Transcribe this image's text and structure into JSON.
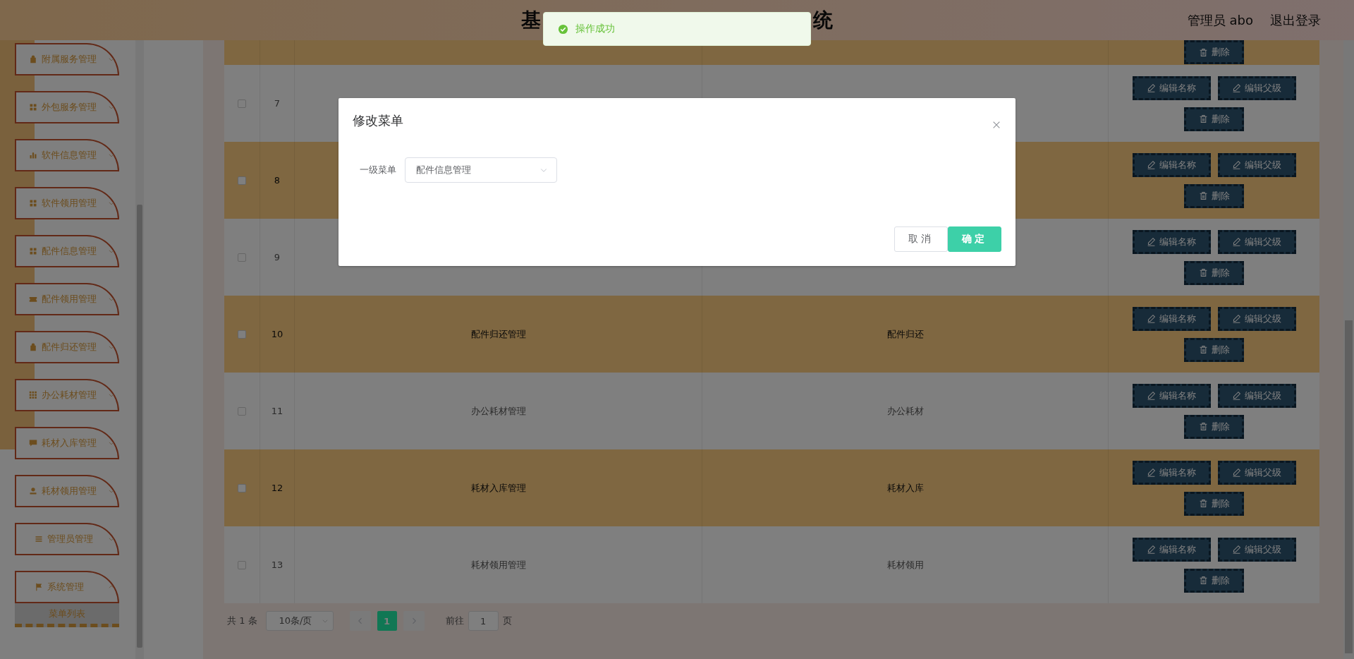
{
  "header": {
    "title_start": "基",
    "title_end": "统",
    "user": "管理员 abo",
    "logout": "退出登录"
  },
  "toast": {
    "kind": "success",
    "message": "操作成功"
  },
  "sidebar": {
    "items": [
      {
        "label": "附属服务管理",
        "expanded": false
      },
      {
        "label": "外包服务管理",
        "expanded": false
      },
      {
        "label": "软件信息管理",
        "expanded": false
      },
      {
        "label": "软件领用管理",
        "expanded": false
      },
      {
        "label": "配件信息管理",
        "expanded": false
      },
      {
        "label": "配件领用管理",
        "expanded": false
      },
      {
        "label": "配件归还管理",
        "expanded": false
      },
      {
        "label": "办公耗材管理",
        "expanded": false
      },
      {
        "label": "耗材入库管理",
        "expanded": false
      },
      {
        "label": "耗材领用管理",
        "expanded": false
      },
      {
        "label": "管理员管理",
        "expanded": false
      },
      {
        "label": "系统管理",
        "expanded": true,
        "children": [
          {
            "label": "菜单列表"
          }
        ]
      }
    ]
  },
  "table": {
    "rows": [
      {
        "actions": [
          "删除"
        ]
      },
      {
        "checked": false,
        "index": "7",
        "actions": [
          "编辑名称",
          "编辑父级",
          "删除"
        ]
      },
      {
        "checked": false,
        "index": "8",
        "actions": [
          "编辑名称",
          "编辑父级",
          "删除"
        ]
      },
      {
        "checked": false,
        "index": "9",
        "actions": [
          "编辑名称",
          "编辑父级",
          "删除"
        ]
      },
      {
        "checked": false,
        "index": "10",
        "name": "配件归还管理",
        "value": "配件归还",
        "actions": [
          "编辑名称",
          "编辑父级",
          "删除"
        ]
      },
      {
        "checked": false,
        "index": "11",
        "name": "办公耗材管理",
        "value": "办公耗材",
        "actions": [
          "编辑名称",
          "编辑父级",
          "删除"
        ]
      },
      {
        "checked": false,
        "index": "12",
        "name": "耗材入库管理",
        "value": "耗材入库",
        "actions": [
          "编辑名称",
          "编辑父级",
          "删除"
        ]
      },
      {
        "checked": false,
        "index": "13",
        "name": "耗材领用管理",
        "value": "耗材领用",
        "actions": [
          "编辑名称",
          "编辑父级",
          "删除"
        ]
      }
    ]
  },
  "pagination": {
    "total": "共 1 条",
    "page_size": "10条/页",
    "pages": [
      {
        "label": "1",
        "selected": true
      }
    ],
    "goto_label": "前往",
    "goto_value": "1",
    "goto_suffix": "页"
  },
  "dialog": {
    "title": "修改菜单",
    "field_label": "一级菜单",
    "select_value": "配件信息管理",
    "cancel": "取消",
    "confirm": "确定"
  }
}
